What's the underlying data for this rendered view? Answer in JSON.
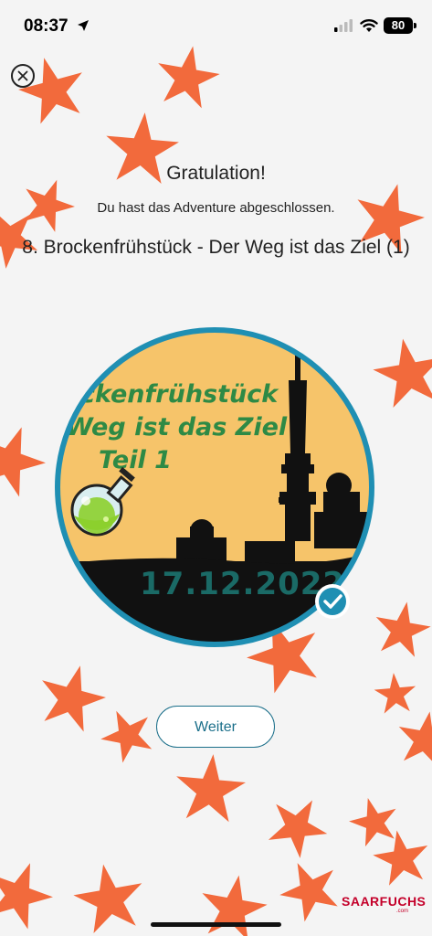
{
  "status_bar": {
    "time": "08:37",
    "battery": "80"
  },
  "dialog": {
    "title": "Gratulation!",
    "subtitle": "Du hast das Adventure abgeschlossen.",
    "adventure_name": "8. Brockenfrühstück - Der Weg ist das Ziel (1)",
    "continue_label": "Weiter"
  },
  "badge": {
    "line1": "ckenfrühstück",
    "line2": "Weg ist das Ziel",
    "line3": "Teil 1",
    "date": "17.12.2022"
  },
  "watermark": {
    "text": "SAARFUCHS",
    "suffix": ".com"
  },
  "colors": {
    "star": "#f26a3c",
    "badge_ring": "#1f8fb3",
    "badge_sky": "#f6c46a",
    "badge_text": "#2e8a45",
    "date_text": "#1a6a66",
    "button_accent": "#1b6f8a"
  },
  "icons": [
    "location-arrow-icon",
    "signal-icon",
    "wifi-icon",
    "battery-icon",
    "close-icon",
    "potion-flask-icon",
    "checkmark-icon"
  ]
}
